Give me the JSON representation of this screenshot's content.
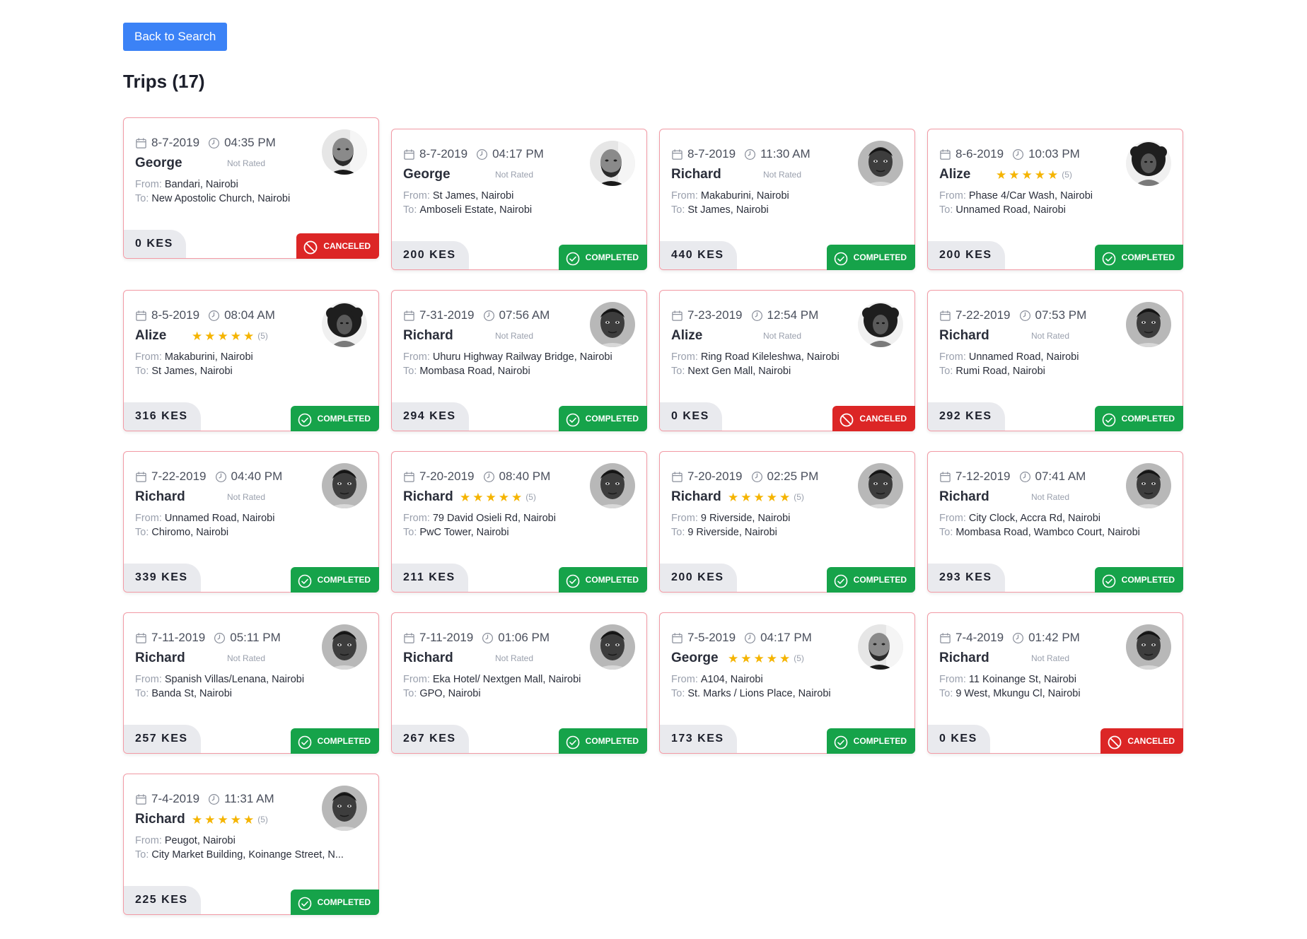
{
  "nav": {
    "back_label": "Back to Search"
  },
  "page": {
    "title": "Trips (17)"
  },
  "labels": {
    "from": "From:",
    "to": "To:",
    "not_rated": "Not Rated"
  },
  "colors": {
    "primary": "#3b82f6",
    "completed": "#16a34a",
    "canceled": "#dc2626",
    "card_border": "#f29aa5",
    "star": "#f5b400"
  },
  "trips": [
    {
      "date": "8-7-2019",
      "time": "04:35 PM",
      "driver": "George",
      "avatar": "george",
      "rating": null,
      "from": "Bandari, Nairobi",
      "to": "New Apostolic Church, Nairobi",
      "fare": "0 KES",
      "status": "CANCELED"
    },
    {
      "date": "8-7-2019",
      "time": "04:17 PM",
      "driver": "George",
      "avatar": "george",
      "rating": null,
      "from": "St James, Nairobi",
      "to": "Amboseli Estate, Nairobi",
      "fare": "200 KES",
      "status": "COMPLETED"
    },
    {
      "date": "8-7-2019",
      "time": "11:30 AM",
      "driver": "Richard",
      "avatar": "richard",
      "rating": null,
      "from": "Makaburini, Nairobi",
      "to": "St James, Nairobi",
      "fare": "440 KES",
      "status": "COMPLETED"
    },
    {
      "date": "8-6-2019",
      "time": "10:03 PM",
      "driver": "Alize",
      "avatar": "alize",
      "rating": "(5)",
      "from": "Phase 4/Car Wash, Nairobi",
      "to": "Unnamed Road, Nairobi",
      "fare": "200 KES",
      "status": "COMPLETED"
    },
    {
      "date": "8-5-2019",
      "time": "08:04 AM",
      "driver": "Alize",
      "avatar": "alize",
      "rating": "(5)",
      "from": "Makaburini, Nairobi",
      "to": "St James, Nairobi",
      "fare": "316 KES",
      "status": "COMPLETED"
    },
    {
      "date": "7-31-2019",
      "time": "07:56 AM",
      "driver": "Richard",
      "avatar": "richard",
      "rating": null,
      "from": "Uhuru Highway Railway Bridge, Nairobi",
      "to": "Mombasa Road, Nairobi",
      "fare": "294 KES",
      "status": "COMPLETED"
    },
    {
      "date": "7-23-2019",
      "time": "12:54 PM",
      "driver": "Alize",
      "avatar": "alize",
      "rating": null,
      "from": "Ring Road Kileleshwa, Nairobi",
      "to": "Next Gen Mall, Nairobi",
      "fare": "0 KES",
      "status": "CANCELED"
    },
    {
      "date": "7-22-2019",
      "time": "07:53 PM",
      "driver": "Richard",
      "avatar": "richard",
      "rating": null,
      "from": "Unnamed Road, Nairobi",
      "to": "Rumi Road, Nairobi",
      "fare": "292 KES",
      "status": "COMPLETED"
    },
    {
      "date": "7-22-2019",
      "time": "04:40 PM",
      "driver": "Richard",
      "avatar": "richard",
      "rating": null,
      "from": "Unnamed Road, Nairobi",
      "to": "Chiromo, Nairobi",
      "fare": "339 KES",
      "status": "COMPLETED"
    },
    {
      "date": "7-20-2019",
      "time": "08:40 PM",
      "driver": "Richard",
      "avatar": "richard",
      "rating": "(5)",
      "from": "79 David Osieli Rd, Nairobi",
      "to": "PwC Tower, Nairobi",
      "fare": "211 KES",
      "status": "COMPLETED"
    },
    {
      "date": "7-20-2019",
      "time": "02:25 PM",
      "driver": "Richard",
      "avatar": "richard",
      "rating": "(5)",
      "from": "9 Riverside, Nairobi",
      "to": "9 Riverside, Nairobi",
      "fare": "200 KES",
      "status": "COMPLETED"
    },
    {
      "date": "7-12-2019",
      "time": "07:41 AM",
      "driver": "Richard",
      "avatar": "richard",
      "rating": null,
      "from": "City Clock, Accra Rd, Nairobi",
      "to": "Mombasa Road, Wambco Court, Nairobi",
      "fare": "293 KES",
      "status": "COMPLETED"
    },
    {
      "date": "7-11-2019",
      "time": "05:11 PM",
      "driver": "Richard",
      "avatar": "richard",
      "rating": null,
      "from": "Spanish Villas/Lenana, Nairobi",
      "to": "Banda St, Nairobi",
      "fare": "257 KES",
      "status": "COMPLETED"
    },
    {
      "date": "7-11-2019",
      "time": "01:06 PM",
      "driver": "Richard",
      "avatar": "richard",
      "rating": null,
      "from": "Eka Hotel/ Nextgen Mall, Nairobi",
      "to": "GPO, Nairobi",
      "fare": "267 KES",
      "status": "COMPLETED"
    },
    {
      "date": "7-5-2019",
      "time": "04:17 PM",
      "driver": "George",
      "avatar": "george",
      "rating": "(5)",
      "from": "A104, Nairobi",
      "to": "St. Marks / Lions Place, Nairobi",
      "fare": "173 KES",
      "status": "COMPLETED"
    },
    {
      "date": "7-4-2019",
      "time": "01:42 PM",
      "driver": "Richard",
      "avatar": "richard",
      "rating": null,
      "from": "11 Koinange St, Nairobi",
      "to": "9 West, Mkungu Cl, Nairobi",
      "fare": "0 KES",
      "status": "CANCELED"
    },
    {
      "date": "7-4-2019",
      "time": "11:31 AM",
      "driver": "Richard",
      "avatar": "richard",
      "rating": "(5)",
      "from": "Peugot, Nairobi",
      "to": "City Market Building, Koinange Street, N...",
      "fare": "225 KES",
      "status": "COMPLETED"
    }
  ]
}
